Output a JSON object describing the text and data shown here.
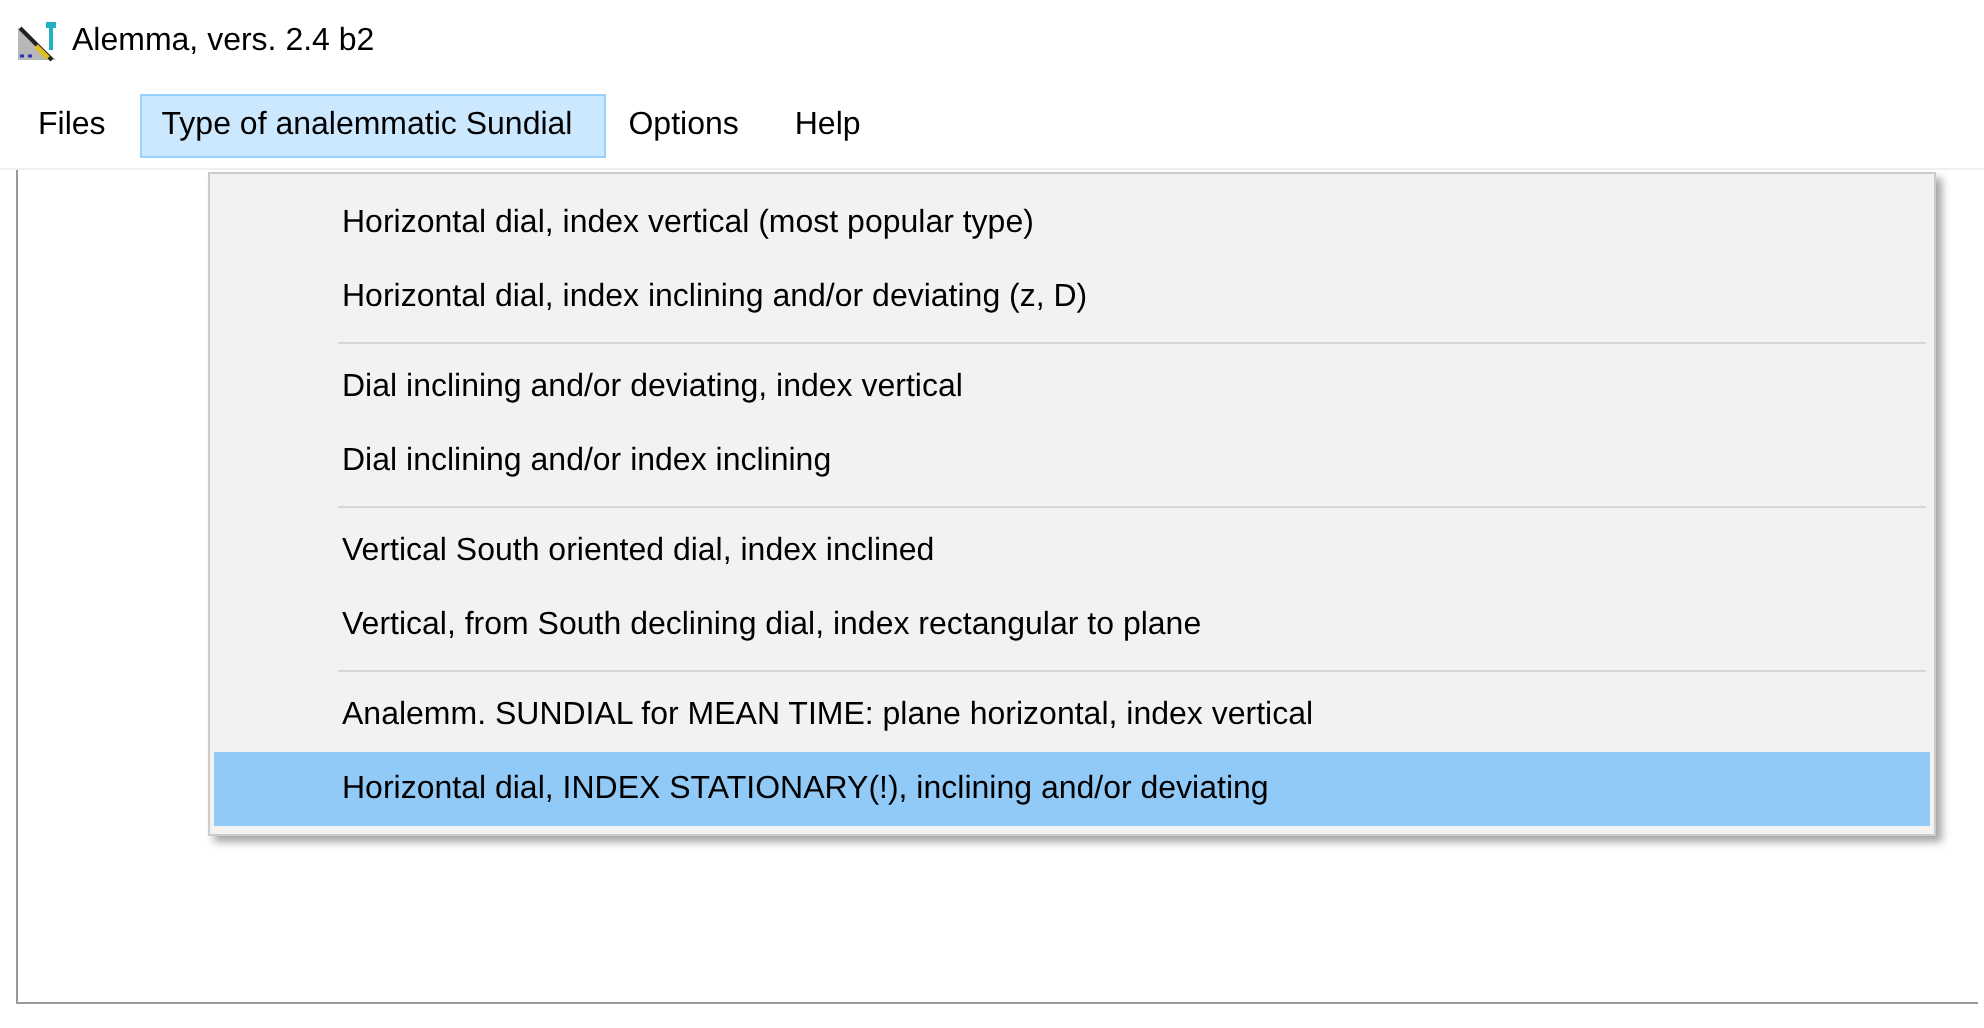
{
  "window": {
    "title": "Alemma,  vers. 2.4 b2"
  },
  "menu_bar": [
    {
      "label": "Files",
      "selected": false
    },
    {
      "label": "Type of analemmatic Sundial",
      "selected": true
    },
    {
      "label": "Options",
      "selected": false
    },
    {
      "label": "Help",
      "selected": false
    }
  ],
  "dropdown": {
    "groups": [
      [
        {
          "label": "Horizontal dial, index vertical (most popular type)",
          "selected": false
        },
        {
          "label": "Horizontal dial, index inclining and/or deviating (z, D)",
          "selected": false
        }
      ],
      [
        {
          "label": "Dial inclining and/or deviating, index vertical",
          "selected": false
        },
        {
          "label": "Dial inclining and/or index inclining",
          "selected": false
        }
      ],
      [
        {
          "label": "Vertical South oriented dial, index inclined",
          "selected": false
        },
        {
          "label": "Vertical, from South declining dial, index rectangular to plane",
          "selected": false
        }
      ],
      [
        {
          "label": "Analemm. SUNDIAL for MEAN TIME: plane horizontal, index vertical",
          "selected": false
        },
        {
          "label": "Horizontal dial, INDEX STATIONARY(!), inclining and/or deviating",
          "selected": true
        }
      ]
    ]
  }
}
